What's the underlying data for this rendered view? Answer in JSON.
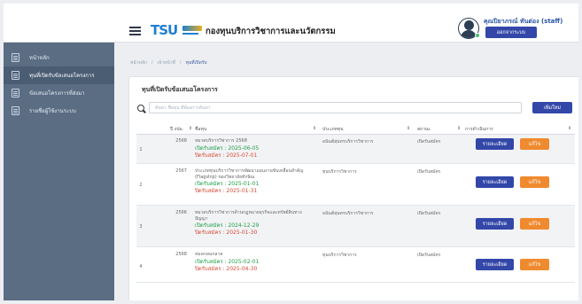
{
  "header": {
    "app_title": "กองทุนบริการวิชาการและนวัตกรรม",
    "logo_text": "TSU",
    "user_name": "คุณปิยาภรณ์ ทันต่อง (staff)",
    "logout_label": "ออกจากระบบ"
  },
  "sidebar": {
    "items": [
      {
        "label": "หน้าหลัก",
        "icon": "home-icon"
      },
      {
        "label": "ทุนที่เปิดรับข้อเสนอโครงการ",
        "icon": "edit-icon"
      },
      {
        "label": "ข้อเสนอโครงการที่ส่งมา",
        "icon": "document-icon"
      },
      {
        "label": "รายชื่อผู้ใช้งานระบบ",
        "icon": "users-icon"
      }
    ],
    "active_index": 1
  },
  "breadcrumb": {
    "items": [
      "หน้าหลัก",
      "เจ้าหน้าที่",
      "ทุนที่เปิดรับ"
    ]
  },
  "card": {
    "title": "ทุนที่เปิดรับข้อเสนอโครงการ",
    "search_placeholder": "ค้นหา ชื่อทุน ที่ต้องการค้นหา",
    "add_label": "เพิ่มใหม่"
  },
  "table": {
    "headers": {
      "year": "ปี งปม.",
      "name": "ชื่อทุน",
      "type": "ประเภททุน",
      "status": "สถานะ",
      "actions": "การดำเนินการ"
    },
    "detail_label": "รายละเอียด",
    "edit_label": "แก้ไข",
    "rows": [
      {
        "num": "1",
        "year": "2568",
        "name": "หมวดบริการวิชาการ 2568",
        "open": "เปิดรับสมัคร : 2025-06-05",
        "close": "ปิดรับสมัคร : 2025-07-01",
        "type": "อนันต์สุนทรบริการวิชาการ",
        "status": "เปิดรับสมัคร"
      },
      {
        "num": "2",
        "year": "2567",
        "name": "ประเภททุนบริการวิชาการพัฒนาแผนงานขับเคลื่อนสำคัญ (Flagship) ของวิทยาลัยทักษิณ",
        "open": "เปิดรับสมัคร : 2025-01-01",
        "close": "ปิดรับสมัคร : 2025-01-31",
        "type": "ทุนบริการวิชาการ",
        "status": "เปิดรับสมัคร"
      },
      {
        "num": "3",
        "year": "2566",
        "name": "หมวดบริการวิชาการด้านกฎหมายธุรกิจและทรัพย์สินทางปัญญา",
        "open": "เปิดรับสมัคร : 2024-12-29",
        "close": "ปิดรับสมัคร : 2025-01-30",
        "type": "อนันต์สุนทรบริการวิชาการ",
        "status": "เปิดรับสมัคร"
      },
      {
        "num": "4",
        "year": "2568",
        "name": "หมดกลนกลาส",
        "open": "เปิดรับสมัคร : 2025-02-01",
        "close": "ปิดรับสมัคร : 2025-04-30",
        "type": "ทุนบริการวิชาการ",
        "status": "เปิดรับสมัคร"
      }
    ]
  },
  "colors": {
    "sidebar_bg": "#5a6d83",
    "primary_button": "#3347a8",
    "edit_button": "#f08a2e",
    "open_date": "#1e9e47",
    "close_date": "#d64a35"
  }
}
